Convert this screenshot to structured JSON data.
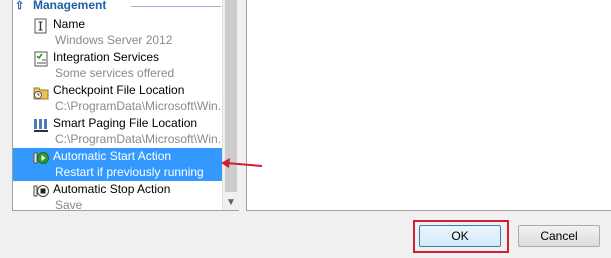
{
  "section": {
    "title": "Management",
    "collapse_glyph": "⌃"
  },
  "items": [
    {
      "label": "Name",
      "value": "Windows Server 2012",
      "icon": "name-icon"
    },
    {
      "label": "Integration Services",
      "value": "Some services offered",
      "icon": "integration-services-icon"
    },
    {
      "label": "Checkpoint File Location",
      "value": "C:\\ProgramData\\Microsoft\\Win...",
      "icon": "checkpoint-folder-icon"
    },
    {
      "label": "Smart Paging File Location",
      "value": "C:\\ProgramData\\Microsoft\\Win...",
      "icon": "smart-paging-icon"
    },
    {
      "label": "Automatic Start Action",
      "value": "Restart if previously running",
      "icon": "start-action-icon",
      "selected": true
    },
    {
      "label": "Automatic Stop Action",
      "value": "Save",
      "icon": "stop-action-icon"
    }
  ],
  "buttons": {
    "ok": "OK",
    "cancel": "Cancel"
  },
  "colors": {
    "selection": "#3399ff",
    "annotation": "#d0202f",
    "header": "#1f5fa8"
  }
}
